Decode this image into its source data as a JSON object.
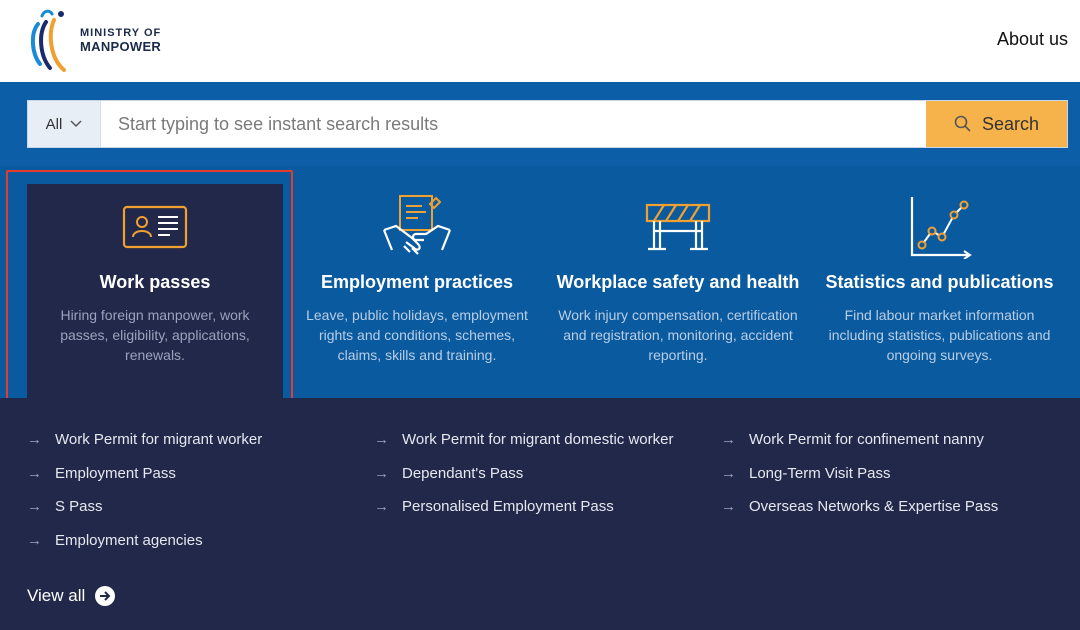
{
  "header": {
    "logo_line1": "MINISTRY OF",
    "logo_line2": "MANPOWER",
    "about_label": "About us"
  },
  "search": {
    "scope_label": "All",
    "placeholder": "Start typing to see instant search results",
    "button_label": "Search"
  },
  "categories": [
    {
      "title": "Work passes",
      "description": "Hiring foreign manpower, work passes, eligibility, applications, renewals.",
      "icon": "id-card-icon",
      "active": true
    },
    {
      "title": "Employment practices",
      "description": "Leave, public holidays, employment rights and conditions, schemes, claims, skills and training.",
      "icon": "handshake-document-icon"
    },
    {
      "title": "Workplace safety and health",
      "description": "Work injury compensation, certification and registration, monitoring, accident reporting.",
      "icon": "barrier-icon"
    },
    {
      "title": "Statistics and publications",
      "description": "Find labour market information including statistics, publications and ongoing surveys.",
      "icon": "line-chart-icon"
    }
  ],
  "links": {
    "col1": [
      "Work Permit for migrant worker",
      "Employment Pass",
      "S Pass",
      "Employment agencies"
    ],
    "col2": [
      "Work Permit for migrant domestic worker",
      "Dependant's Pass",
      "Personalised Employment Pass"
    ],
    "col3": [
      "Work Permit for confinement nanny",
      "Long-Term Visit Pass",
      "Overseas Networks & Expertise Pass"
    ]
  },
  "view_all_label": "View all",
  "colors": {
    "brand_blue": "#0a5aa0",
    "dark_navy": "#22284a",
    "accent_orange": "#f7b34b",
    "icon_orange": "#f0a030",
    "highlight_red": "#e53b2d"
  }
}
